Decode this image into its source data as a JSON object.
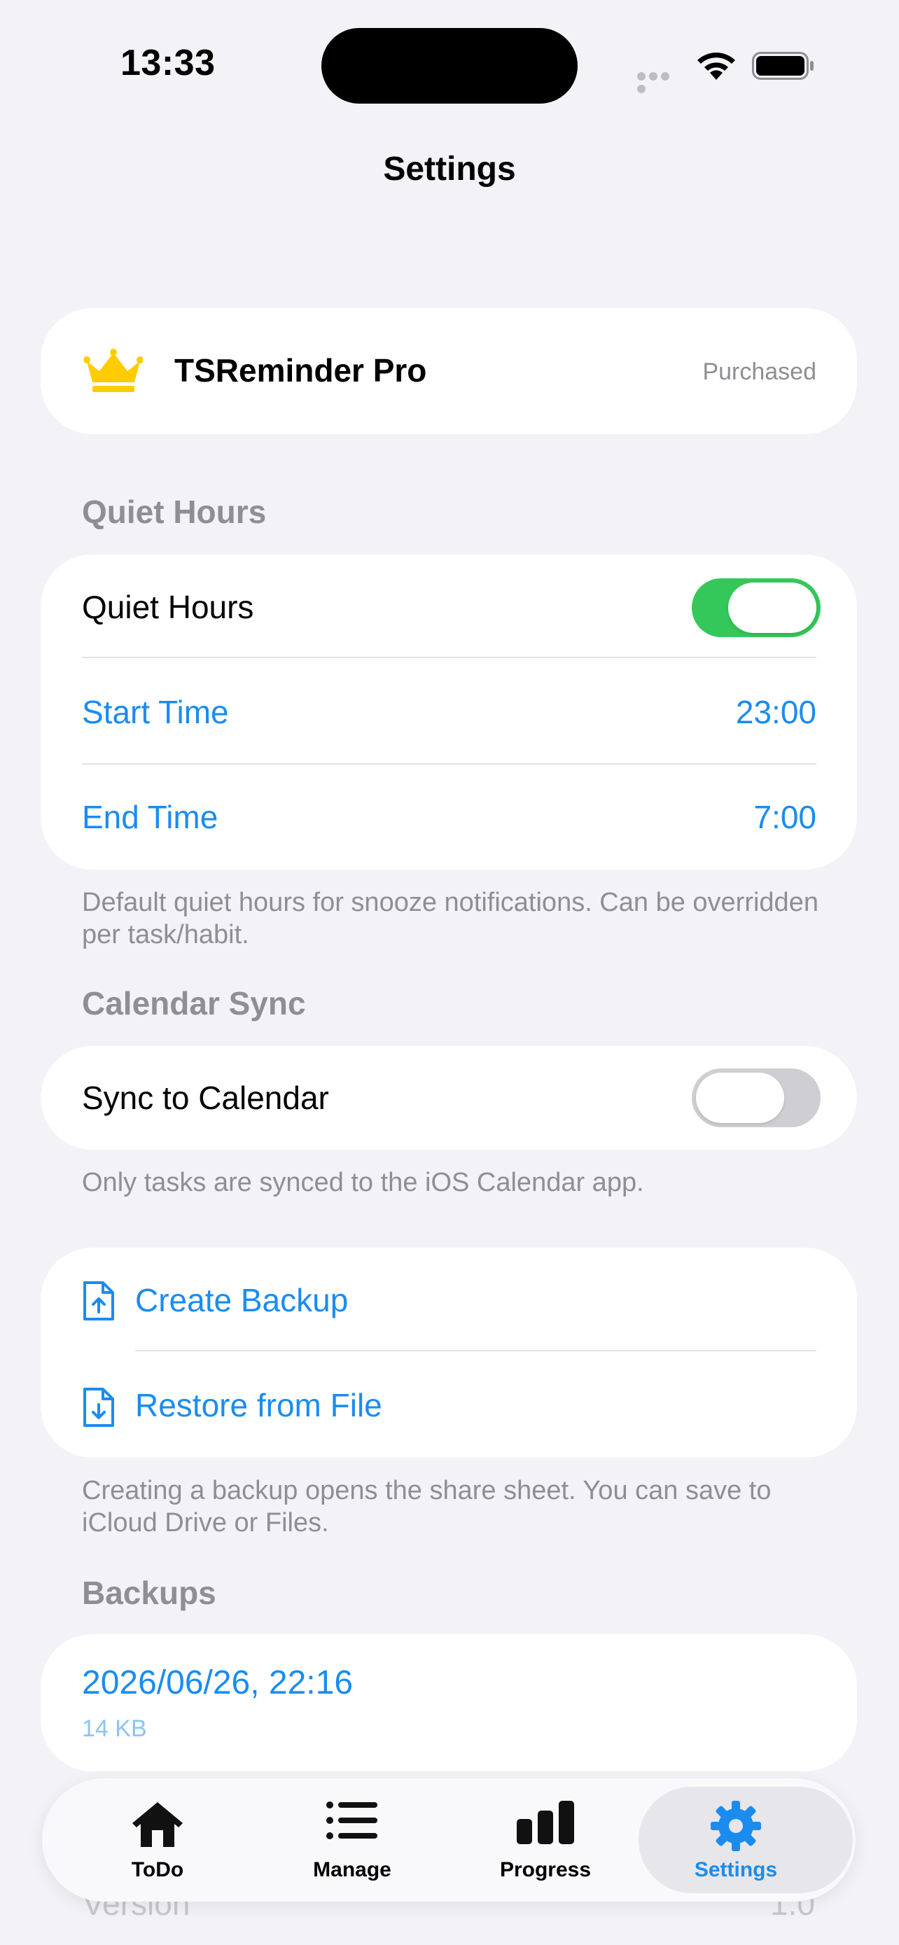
{
  "status_bar": {
    "time": "13:33"
  },
  "nav": {
    "title": "Settings"
  },
  "pro": {
    "title": "TSReminder Pro",
    "status": "Purchased",
    "icon": "crown-icon"
  },
  "quiet_hours": {
    "header": "Quiet Hours",
    "toggle_label": "Quiet Hours",
    "toggle_on": true,
    "start_label": "Start Time",
    "start_value": "23:00",
    "end_label": "End Time",
    "end_value": "7:00",
    "footer": "Default quiet hours for snooze notifications. Can be overridden per task/habit."
  },
  "calendar_sync": {
    "header": "Calendar Sync",
    "toggle_label": "Sync to Calendar",
    "toggle_on": false,
    "footer": "Only tasks are synced to the iOS Calendar app."
  },
  "backup_actions": {
    "create_label": "Create Backup",
    "restore_label": "Restore from File",
    "footer": "Creating a backup opens the share sheet. You can save to iCloud Drive or Files."
  },
  "backups": {
    "header": "Backups",
    "items": [
      {
        "date": "2026/06/26, 22:16",
        "size": "14 KB"
      }
    ]
  },
  "about": {
    "version_label": "Version",
    "version_value": "1.0"
  },
  "tabbar": {
    "tabs": [
      {
        "label": "ToDo",
        "icon": "house-icon"
      },
      {
        "label": "Manage",
        "icon": "list-icon"
      },
      {
        "label": "Progress",
        "icon": "chart-icon"
      },
      {
        "label": "Settings",
        "icon": "gear-icon",
        "active": true
      }
    ]
  },
  "colors": {
    "accent": "#1A8CF0",
    "toggle_on": "#34C759",
    "background": "#F2F2F7",
    "crown": "#FFCC00"
  }
}
